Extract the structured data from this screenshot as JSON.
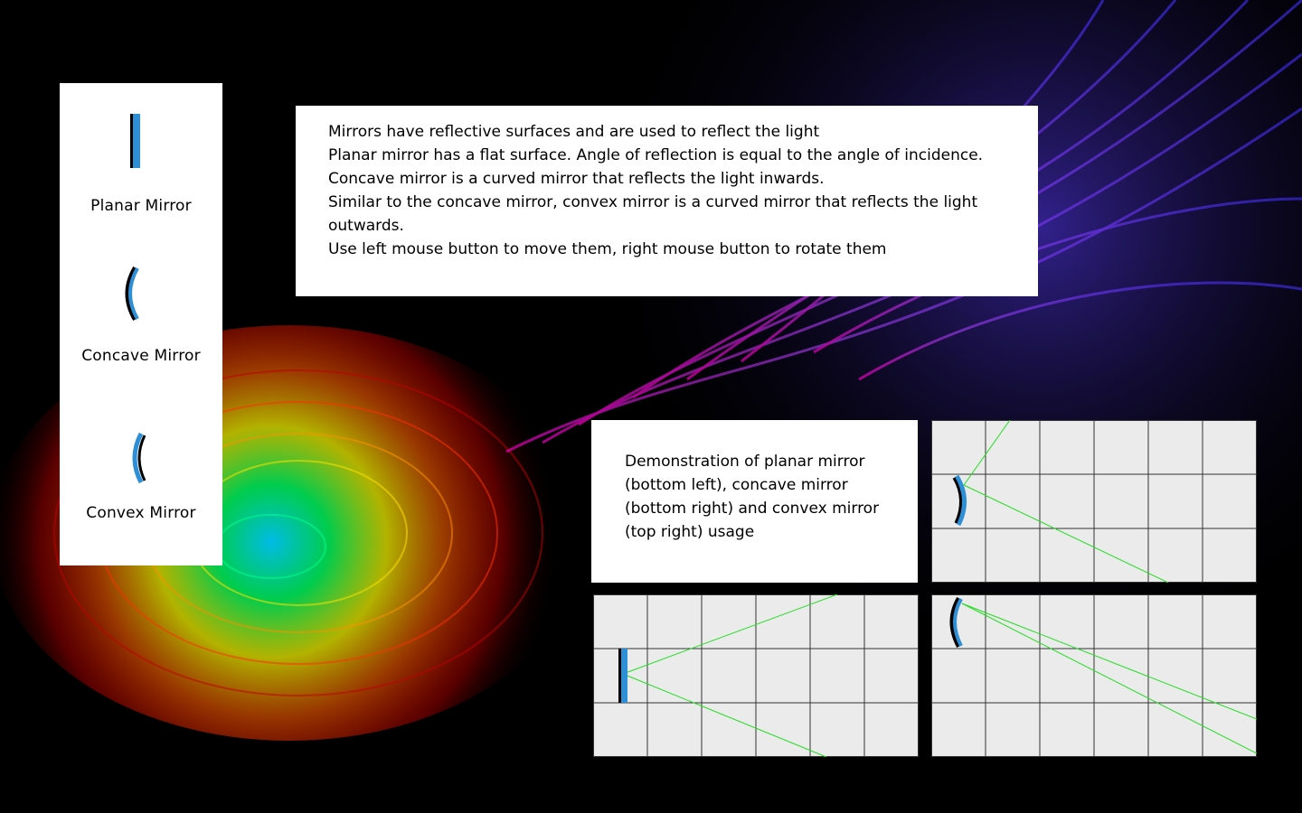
{
  "palette": {
    "items": [
      {
        "label": "Planar Mirror",
        "icon": "planar-mirror-icon"
      },
      {
        "label": "Concave Mirror",
        "icon": "concave-mirror-icon"
      },
      {
        "label": "Convex Mirror",
        "icon": "convex-mirror-icon"
      }
    ]
  },
  "info": {
    "lines": [
      "Mirrors have reflective surfaces and are used to reflect the light",
      "Planar mirror has a flat surface. Angle of reflection is equal to the angle of incidence.",
      "Concave mirror is a curved mirror that reflects the light inwards.",
      "Similar to the concave mirror, convex mirror is a curved mirror that reflects the light outwards.",
      "Use left mouse button to move them, right mouse button to rotate them"
    ]
  },
  "demo": {
    "caption_lines": [
      "Demonstration of planar mirror",
      "(bottom left), concave mirror",
      "(bottom right) and convex mirror",
      "(top right) usage"
    ],
    "panels": [
      "convex-demo",
      "planar-demo",
      "concave-demo"
    ]
  },
  "colors": {
    "mirror_face": "#2d8fd6",
    "mirror_back": "#000000",
    "ray": "#22dd22",
    "grid_bg": "#ebebeb",
    "grid_line": "#333333",
    "panel_bg": "#ffffff"
  }
}
